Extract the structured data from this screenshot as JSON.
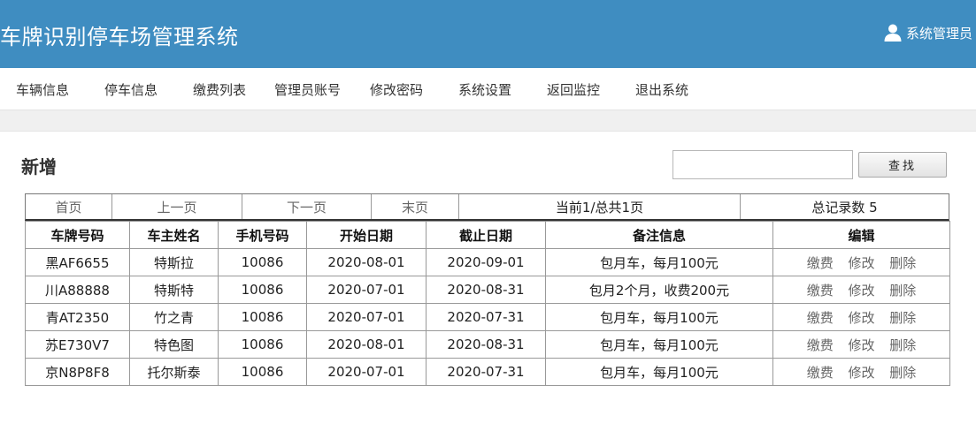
{
  "header": {
    "title": "车牌识别停车场管理系统",
    "user_icon": "user-icon",
    "user_name": "系统管理员"
  },
  "nav": {
    "items": [
      {
        "label": "车辆信息"
      },
      {
        "label": "停车信息"
      },
      {
        "label": "缴费列表"
      },
      {
        "label": "管理员账号"
      },
      {
        "label": "修改密码"
      },
      {
        "label": "系统设置"
      },
      {
        "label": "返回监控"
      },
      {
        "label": "退出系统"
      }
    ]
  },
  "main": {
    "add_label": "新增",
    "search": {
      "value": "",
      "placeholder": ""
    },
    "search_button": "查找",
    "pager": {
      "first": "首页",
      "prev": "上一页",
      "next": "下一页",
      "last": "末页",
      "page_info": "当前1/总共1页",
      "total_info": "总记录数 5"
    },
    "table": {
      "headers": [
        "车牌号码",
        "车主姓名",
        "手机号码",
        "开始日期",
        "截止日期",
        "备注信息",
        "编辑"
      ],
      "actions": {
        "pay": "缴费",
        "edit": "修改",
        "delete": "删除"
      },
      "rows": [
        {
          "plate": "黑AF6655",
          "owner": "特斯拉",
          "phone": "10086",
          "start": "2020-08-01",
          "end": "2020-09-01",
          "note": "包月车，每月100元"
        },
        {
          "plate": "川A88888",
          "owner": "特斯特",
          "phone": "10086",
          "start": "2020-07-01",
          "end": "2020-08-31",
          "note": "包月2个月，收费200元"
        },
        {
          "plate": "青AT2350",
          "owner": "竹之青",
          "phone": "10086",
          "start": "2020-07-01",
          "end": "2020-07-31",
          "note": "包月车，每月100元"
        },
        {
          "plate": "苏E730V7",
          "owner": "特色图",
          "phone": "10086",
          "start": "2020-08-01",
          "end": "2020-08-31",
          "note": "包月车，每月100元"
        },
        {
          "plate": "京N8P8F8",
          "owner": "托尔斯泰",
          "phone": "10086",
          "start": "2020-07-01",
          "end": "2020-07-31",
          "note": "包月车，每月100元"
        }
      ]
    }
  }
}
